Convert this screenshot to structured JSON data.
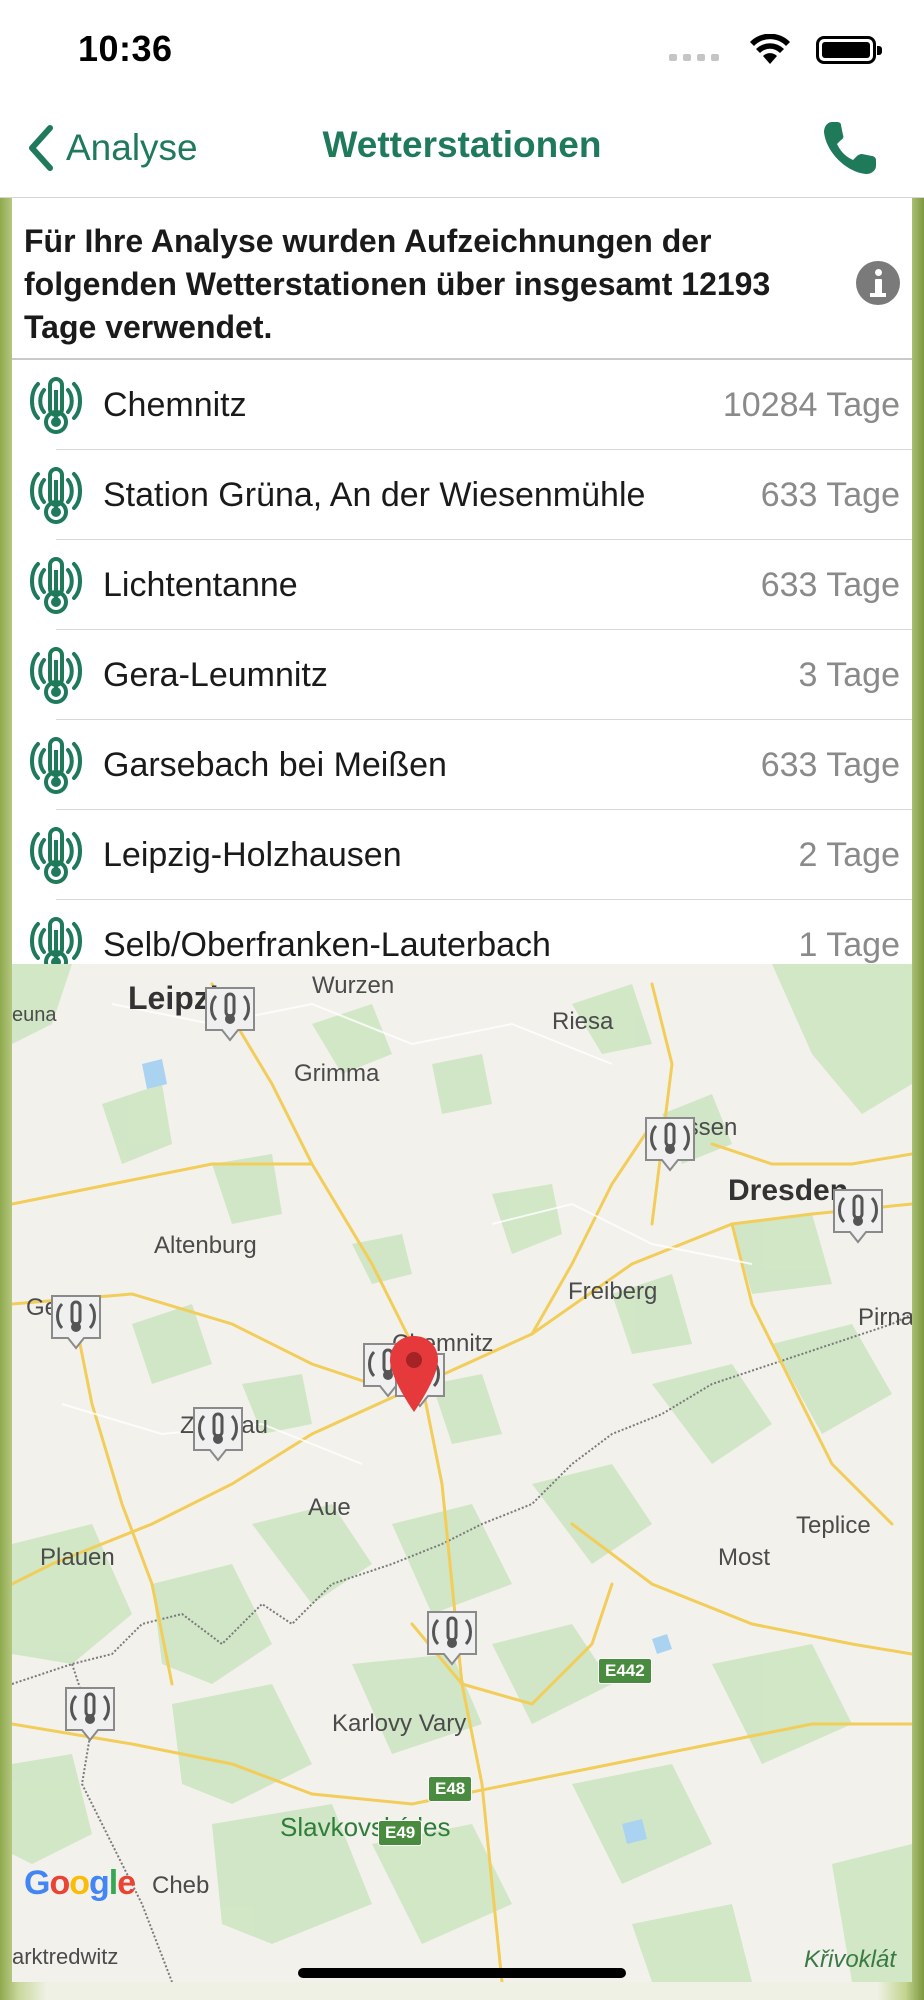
{
  "status": {
    "time": "10:36"
  },
  "nav": {
    "back_label": "Analyse",
    "title": "Wetterstationen"
  },
  "intro": {
    "text": "Für Ihre Analyse wurden Aufzeichnungen der folgenden Wetterstationen über insgesamt 12193 Tage verwendet."
  },
  "stations": [
    {
      "name": "Chemnitz",
      "days": "10284 Tage"
    },
    {
      "name": "Station Grüna, An der Wiesenmühle",
      "days": "633 Tage"
    },
    {
      "name": "Lichtentanne",
      "days": "633 Tage"
    },
    {
      "name": "Gera-Leumnitz",
      "days": "3 Tage"
    },
    {
      "name": "Garsebach bei Meißen",
      "days": "633 Tage"
    },
    {
      "name": "Leipzig-Holzhausen",
      "days": "2 Tage"
    },
    {
      "name": "Selb/Oberfranken-Lauterbach",
      "days": "1 Tage"
    }
  ],
  "map": {
    "labels": {
      "leipzig": "Leipzig",
      "wurzen": "Wurzen",
      "riesa": "Riesa",
      "euna": "euna",
      "grimma": "Grimma",
      "meissen": "Meissen",
      "dresden": "Dresden",
      "altenburg": "Altenburg",
      "gera": "Gera",
      "freiberg": "Freiberg",
      "pirna": "Pirna",
      "chemnitz": "Chemnitz",
      "zwickau": "Zwickau",
      "aue": "Aue",
      "teplice": "Teplice",
      "plauen": "Plauen",
      "most": "Most",
      "karlovy_vary": "Karlovy Vary",
      "cheb": "Cheb",
      "slavkovsky_les": "Slavkovský les",
      "marktredwitz": "arktredwitz",
      "krivoklat": "Křivoklát"
    },
    "roads": {
      "e442": "E442",
      "e48": "E48",
      "e49": "E49"
    },
    "attribution": "Google"
  },
  "colors": {
    "accent": "#1f7a5a",
    "pin_red": "#e5393b"
  }
}
